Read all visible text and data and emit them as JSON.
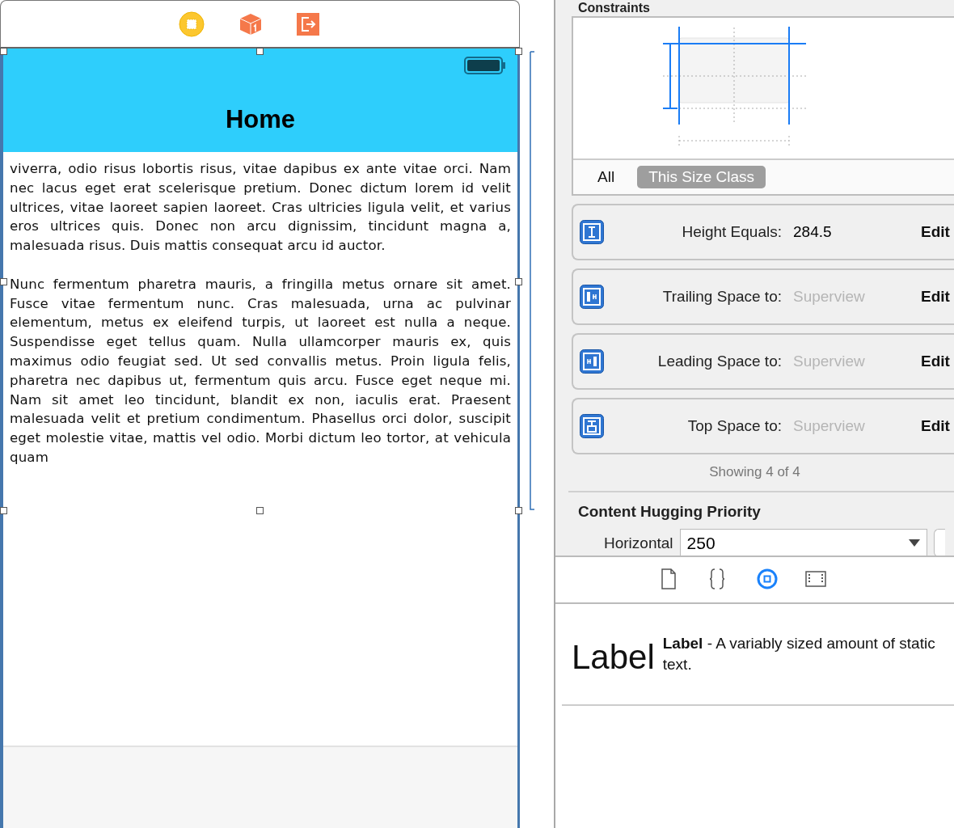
{
  "scene_bar": {
    "icons": [
      {
        "kind": "view-controller"
      },
      {
        "kind": "first-responder"
      },
      {
        "kind": "exit"
      }
    ]
  },
  "nav_bar": {
    "title": "Home"
  },
  "text_view": {
    "paragraphs": [
      "viverra, odio risus lobortis risus, vitae dapibus ex ante vitae orci. Nam nec lacus eget erat scelerisque pretium. Donec dictum lorem id velit ultrices, vitae laoreet sapien laoreet. Cras ultricies ligula velit, et varius eros ultrices quis. Donec non arcu dignissim, tincidunt magna a, malesuada risus. Duis mattis consequat arcu id auctor.",
      "Nunc fermentum pharetra mauris, a fringilla metus ornare sit amet. Fusce vitae fermentum nunc. Cras malesuada, urna ac pulvinar elementum, metus ex eleifend turpis, ut laoreet est nulla a neque. Suspendisse eget tellus quam. Nulla ullamcorper mauris ex, quis maximus odio feugiat sed. Ut sed convallis metus. Proin ligula felis, pharetra nec dapibus ut, fermentum quis arcu. Fusce eget neque mi. Nam sit amet leo tincidunt, blandit ex non, iaculis erat. Praesent malesuada velit et pretium condimentum. Phasellus orci dolor, suscipit eget molestie vitae, mattis vel odio. Morbi dictum leo tortor, at vehicula quam"
    ]
  },
  "inspector": {
    "section_title": "Constraints",
    "scope_tabs": [
      {
        "label": "All",
        "selected": false
      },
      {
        "label": "This Size Class",
        "selected": true
      }
    ],
    "constraints": [
      {
        "kind": "height",
        "label": "Height Equals:",
        "value": "284.5",
        "value_dimmed": false,
        "action": "Edit"
      },
      {
        "kind": "trailing",
        "label": "Trailing Space to:",
        "value": "Superview",
        "value_dimmed": true,
        "action": "Edit"
      },
      {
        "kind": "leading",
        "label": "Leading Space to:",
        "value": "Superview",
        "value_dimmed": true,
        "action": "Edit"
      },
      {
        "kind": "top",
        "label": "Top Space to:",
        "value": "Superview",
        "value_dimmed": true,
        "action": "Edit"
      }
    ],
    "showing": "Showing 4 of 4",
    "hugging": {
      "title": "Content Hugging Priority",
      "label": "Horizontal",
      "value": "250"
    }
  },
  "library_tabs": [
    {
      "kind": "file",
      "selected": false
    },
    {
      "kind": "braces",
      "selected": false
    },
    {
      "kind": "object",
      "selected": true
    },
    {
      "kind": "media",
      "selected": false
    }
  ],
  "library_item": {
    "preview": "Label",
    "name": "Label",
    "description": " - A variably sized amount of static text."
  }
}
